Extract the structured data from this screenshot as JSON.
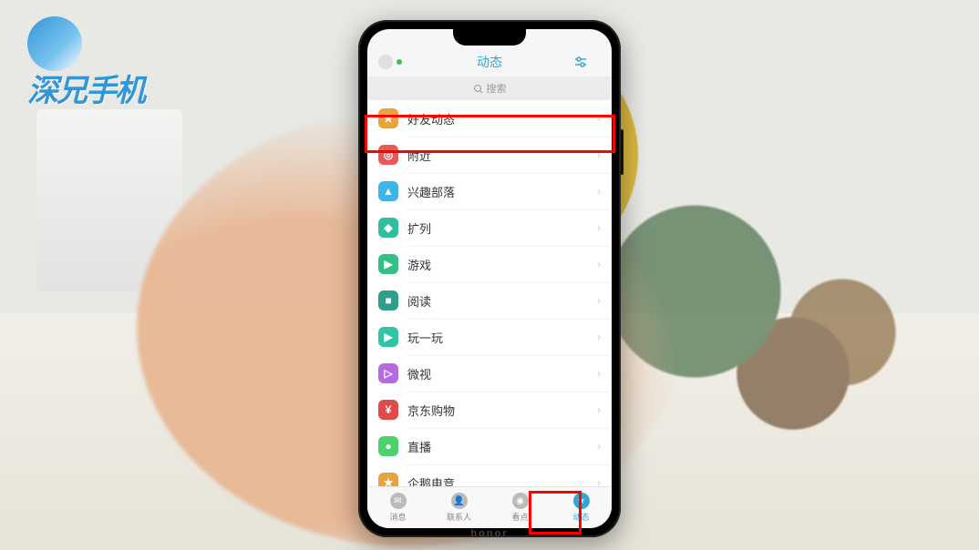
{
  "watermark_text": "深兄手机",
  "phone_brand": "honor",
  "header": {
    "title": "动态"
  },
  "search": {
    "placeholder": "搜索"
  },
  "rows": [
    {
      "label": "好友动态",
      "icon_color": "#e8a43c",
      "icon_glyph": "★"
    },
    {
      "label": "附近",
      "icon_color": "#e85a5a",
      "icon_glyph": "◎"
    },
    {
      "label": "兴趣部落",
      "icon_color": "#3cb6e8",
      "icon_glyph": "▲"
    },
    {
      "label": "扩列",
      "icon_color": "#2fbfa0",
      "icon_glyph": "◆"
    },
    {
      "label": "游戏",
      "icon_color": "#34c084",
      "icon_glyph": "▶"
    },
    {
      "label": "阅读",
      "icon_color": "#2c9e8a",
      "icon_glyph": "■"
    },
    {
      "label": "玩一玩",
      "icon_color": "#2fc6a8",
      "icon_glyph": "▶"
    },
    {
      "label": "微视",
      "icon_color": "#b56be0",
      "icon_glyph": "▷"
    },
    {
      "label": "京东购物",
      "icon_color": "#e04a4a",
      "icon_glyph": "¥"
    },
    {
      "label": "直播",
      "icon_color": "#4cd26a",
      "icon_glyph": "●"
    },
    {
      "label": "企鹅电竞",
      "icon_color": "#e8a43c",
      "icon_glyph": "★"
    }
  ],
  "tabs": [
    {
      "label": "消息",
      "glyph": "✉",
      "active": false
    },
    {
      "label": "联系人",
      "glyph": "👤",
      "active": false
    },
    {
      "label": "看点",
      "glyph": "◉",
      "active": false
    },
    {
      "label": "动态",
      "glyph": "★",
      "active": true
    }
  ]
}
